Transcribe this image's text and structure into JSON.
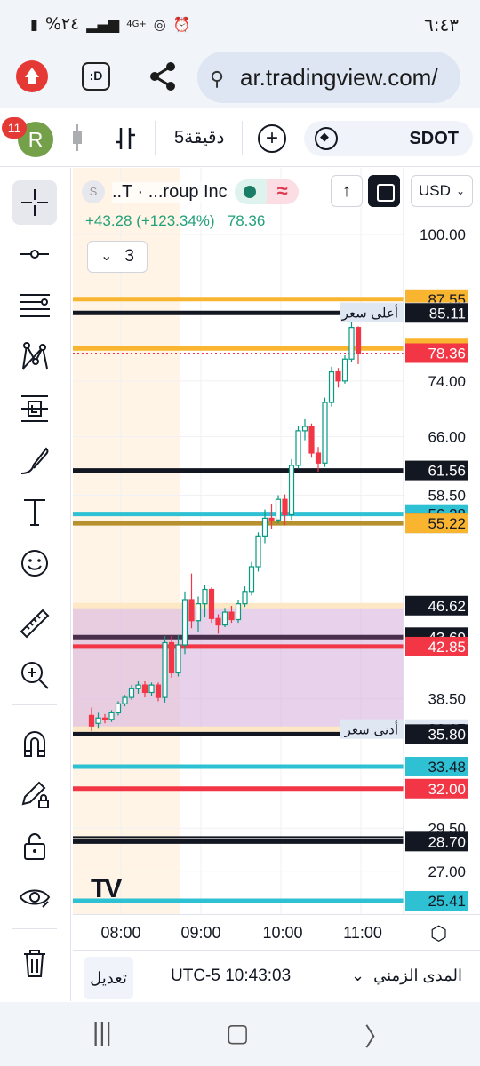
{
  "status_bar": {
    "time": "٦:٤٣",
    "battery": "%٢٤",
    "network": "4G+"
  },
  "browser": {
    "url": "ar.tradingview.com/",
    "tab_label": ":D"
  },
  "toolbar": {
    "notification_count": "11",
    "avatar_letter": "R",
    "interval": "5دقيقة",
    "symbol": "SDOT"
  },
  "legend": {
    "symbol_prefix": "S",
    "name": "..T · ...roup Inc",
    "change": "+43.28 (+123.34%)",
    "price": "78.36",
    "collapsed_count": "3",
    "currency": "USD"
  },
  "price_scale": {
    "ticks": [
      "100.00",
      "74.00",
      "66.00",
      "58.50",
      "38.50",
      "29.50",
      "27.00"
    ],
    "tags": [
      {
        "value": "87.55",
        "bg": "#f9b530",
        "fg": "#131722"
      },
      {
        "value": "85.22",
        "bg": "#dfe7f3",
        "fg": "#131722",
        "note": "أعلى سعر"
      },
      {
        "value": "85.11",
        "bg": "#131722",
        "fg": "#ffffff"
      },
      {
        "value": "79.12",
        "bg": "#f9b530",
        "fg": "#131722"
      },
      {
        "value": "78.36",
        "bg": "#f23645",
        "fg": "#ffffff"
      },
      {
        "value": "61.56",
        "bg": "#131722",
        "fg": "#ffffff"
      },
      {
        "value": "56.28",
        "bg": "#2ec1d3",
        "fg": "#131722"
      },
      {
        "value": "55.22",
        "bg": "#131722",
        "fg": "#ffffff"
      },
      {
        "value": "55.22",
        "bg": "#f9b530",
        "fg": "#131722"
      },
      {
        "value": "46.62",
        "bg": "#131722",
        "fg": "#ffffff"
      },
      {
        "value": "43.69",
        "bg": "#131722",
        "fg": "#ffffff"
      },
      {
        "value": "42.85",
        "bg": "#f23645",
        "fg": "#ffffff"
      },
      {
        "value": "36.17",
        "bg": "#dfe7f3",
        "fg": "#131722",
        "note": "أدنى سعر"
      },
      {
        "value": "35.80",
        "bg": "#131722",
        "fg": "#ffffff"
      },
      {
        "value": "33.48",
        "bg": "#2ec1d3",
        "fg": "#131722"
      },
      {
        "value": "32.00",
        "bg": "#f23645",
        "fg": "#ffffff"
      },
      {
        "value": "28.70",
        "bg": "#131722",
        "fg": "#ffffff"
      },
      {
        "value": "25.41",
        "bg": "#2ec1d3",
        "fg": "#131722"
      }
    ]
  },
  "chart_data": {
    "type": "candlestick",
    "x_ticks": [
      "08:00",
      "09:00",
      "10:00",
      "11:00"
    ],
    "candles": [
      {
        "t": "07:38",
        "o": 37.2,
        "h": 37.8,
        "l": 36.0,
        "c": 36.4
      },
      {
        "t": "07:43",
        "o": 36.6,
        "h": 37.4,
        "l": 36.2,
        "c": 37.0
      },
      {
        "t": "07:48",
        "o": 37.0,
        "h": 37.3,
        "l": 36.6,
        "c": 36.9
      },
      {
        "t": "07:53",
        "o": 36.9,
        "h": 37.6,
        "l": 36.7,
        "c": 37.4
      },
      {
        "t": "07:58",
        "o": 37.4,
        "h": 38.3,
        "l": 37.2,
        "c": 38.1
      },
      {
        "t": "08:03",
        "o": 38.1,
        "h": 38.8,
        "l": 37.9,
        "c": 38.6
      },
      {
        "t": "08:08",
        "o": 38.6,
        "h": 39.6,
        "l": 38.4,
        "c": 39.3
      },
      {
        "t": "08:13",
        "o": 39.3,
        "h": 39.9,
        "l": 38.9,
        "c": 39.6
      },
      {
        "t": "08:18",
        "o": 39.6,
        "h": 39.9,
        "l": 38.6,
        "c": 39.0
      },
      {
        "t": "08:23",
        "o": 39.0,
        "h": 39.8,
        "l": 38.7,
        "c": 39.6
      },
      {
        "t": "08:28",
        "o": 39.6,
        "h": 39.8,
        "l": 38.3,
        "c": 38.6
      },
      {
        "t": "08:33",
        "o": 38.6,
        "h": 43.8,
        "l": 38.2,
        "c": 43.2
      },
      {
        "t": "08:38",
        "o": 43.2,
        "h": 43.8,
        "l": 40.2,
        "c": 40.6
      },
      {
        "t": "08:43",
        "o": 40.6,
        "h": 43.9,
        "l": 40.3,
        "c": 43.0
      },
      {
        "t": "08:48",
        "o": 43.0,
        "h": 48.0,
        "l": 42.2,
        "c": 47.2
      },
      {
        "t": "08:53",
        "o": 47.2,
        "h": 49.8,
        "l": 44.5,
        "c": 45.2
      },
      {
        "t": "08:58",
        "o": 45.2,
        "h": 47.5,
        "l": 44.2,
        "c": 46.8
      },
      {
        "t": "09:03",
        "o": 46.8,
        "h": 48.6,
        "l": 45.5,
        "c": 48.2
      },
      {
        "t": "09:08",
        "o": 48.2,
        "h": 48.4,
        "l": 45.0,
        "c": 45.4
      },
      {
        "t": "09:13",
        "o": 45.4,
        "h": 45.8,
        "l": 44.0,
        "c": 44.8
      },
      {
        "t": "09:18",
        "o": 44.8,
        "h": 46.4,
        "l": 44.6,
        "c": 46.0
      },
      {
        "t": "09:23",
        "o": 46.0,
        "h": 46.6,
        "l": 45.0,
        "c": 45.3
      },
      {
        "t": "09:28",
        "o": 45.3,
        "h": 47.2,
        "l": 45.0,
        "c": 46.8
      },
      {
        "t": "09:33",
        "o": 46.8,
        "h": 48.5,
        "l": 46.5,
        "c": 48.0
      },
      {
        "t": "09:38",
        "o": 48.0,
        "h": 51.0,
        "l": 47.6,
        "c": 50.5
      },
      {
        "t": "09:43",
        "o": 50.5,
        "h": 54.2,
        "l": 50.0,
        "c": 53.8
      },
      {
        "t": "09:48",
        "o": 53.8,
        "h": 56.8,
        "l": 53.0,
        "c": 55.8
      },
      {
        "t": "09:53",
        "o": 55.8,
        "h": 57.5,
        "l": 54.6,
        "c": 55.6
      },
      {
        "t": "09:58",
        "o": 55.6,
        "h": 58.5,
        "l": 55.2,
        "c": 58.0
      },
      {
        "t": "10:03",
        "o": 58.0,
        "h": 58.6,
        "l": 55.0,
        "c": 56.2
      },
      {
        "t": "10:08",
        "o": 56.2,
        "h": 63.0,
        "l": 55.6,
        "c": 62.2
      },
      {
        "t": "10:13",
        "o": 62.2,
        "h": 67.5,
        "l": 61.8,
        "c": 66.8
      },
      {
        "t": "10:18",
        "o": 66.8,
        "h": 68.4,
        "l": 65.5,
        "c": 67.4
      },
      {
        "t": "10:23",
        "o": 67.4,
        "h": 67.8,
        "l": 63.2,
        "c": 63.8
      },
      {
        "t": "10:28",
        "o": 63.8,
        "h": 64.6,
        "l": 61.4,
        "c": 62.5
      },
      {
        "t": "10:33",
        "o": 62.5,
        "h": 71.5,
        "l": 62.0,
        "c": 70.8
      },
      {
        "t": "10:38",
        "o": 70.8,
        "h": 76.2,
        "l": 70.2,
        "c": 75.4
      },
      {
        "t": "10:43",
        "o": 75.4,
        "h": 76.0,
        "l": 73.0,
        "c": 74.0
      },
      {
        "t": "10:48",
        "o": 74.0,
        "h": 78.0,
        "l": 73.6,
        "c": 77.4
      },
      {
        "t": "10:53",
        "o": 77.4,
        "h": 85.22,
        "l": 77.0,
        "c": 82.6
      },
      {
        "t": "10:58",
        "o": 82.6,
        "h": 82.8,
        "l": 76.6,
        "c": 78.36
      }
    ],
    "lines": [
      {
        "value": 87.55,
        "color": "#f9b530"
      },
      {
        "value": 85.11,
        "color": "#131722"
      },
      {
        "value": 79.12,
        "color": "#f9b530"
      },
      {
        "value": 61.56,
        "color": "#131722"
      },
      {
        "value": 56.28,
        "color": "#2ec1d3"
      },
      {
        "value": 55.22,
        "color": "#b8912f"
      },
      {
        "value": 43.69,
        "color": "#4a2f4d"
      },
      {
        "value": 42.85,
        "color": "#f23645"
      },
      {
        "value": 35.8,
        "color": "#131722"
      },
      {
        "value": 33.48,
        "color": "#2ec1d3"
      },
      {
        "value": 32.0,
        "color": "#f23645"
      },
      {
        "value": 28.7,
        "color": "#131722"
      },
      {
        "value": 25.41,
        "color": "#2ec1d3"
      }
    ],
    "zones": [
      {
        "from": 36.17,
        "to": 46.62,
        "color": "#d9b2dd"
      }
    ],
    "session_shade_until": "08:43",
    "log_scale": true,
    "colors": {
      "up": "#089981",
      "down": "#f23645"
    }
  },
  "bottom_bar": {
    "edit_label": "تعديل",
    "clock": "UTC-5 10:43:03",
    "range_label": "المدى الزمني"
  }
}
